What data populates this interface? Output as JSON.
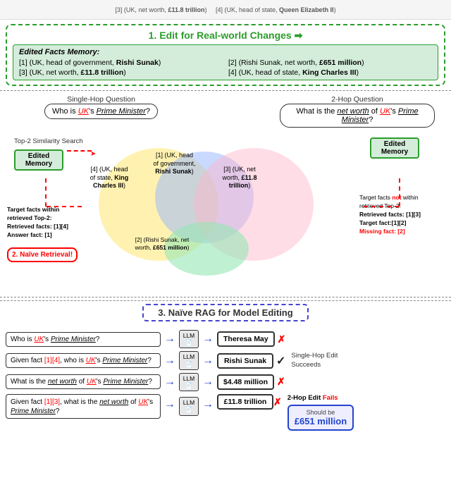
{
  "top_bar": {
    "text": "[3] (UK, net worth, £11.8 trillion)    [4] (UK, head of state, Queen Elizabeth II)"
  },
  "section1": {
    "title": "1. Edit for Real-world Changes",
    "facts_title": "Edited Facts Memory:",
    "facts": [
      {
        "num": "[1]",
        "content": "(UK, head of government, ",
        "bold": "Rishi Sunak",
        "end": ")"
      },
      {
        "num": "[2]",
        "content": "(Rishi Sunak, net worth, ",
        "bold": "£651 million",
        "end": ")"
      },
      {
        "num": "[3]",
        "content": "(UK, net worth, ",
        "bold": "£11.8 trillion",
        "end": ")"
      },
      {
        "num": "[4]",
        "content": "(UK, head of state, ",
        "bold": "King Charles III",
        "end": ")"
      }
    ]
  },
  "section2": {
    "q_left_label": "Single-Hop Question",
    "q_right_label": "2-Hop Question",
    "q_left": "Who is UK's Prime Minister?",
    "q_right": "What is the net worth of UK's Prime Minister?",
    "top2_label": "Top-2 Similarity Search",
    "edited_memory": "Edited Memory",
    "venn": {
      "left_text": "[4] (UK, head\nof state, King\nCharles III)",
      "center_text": "[1] (UK, head\nof government,\nRishi Sunak)",
      "right_text": "[3] (UK, net\nworth, £11.8\ntrillion)",
      "bottom_text": "[2] (Rishi Sunak, net\nworth, £651 million)"
    },
    "left_target": "Target facts within\nretrieved Top-2:\nRetrieved facts: [1][4]\nAnswer fact: [1]",
    "naive_retrieval": "2. Naïve Retrieval!",
    "right_target": "Target facts not within\nretrieved Top-2.\nRetrieved facts: [1][3]\nTarget fact:[1][2]\nMissing fact: [2]"
  },
  "section3": {
    "title": "3. Naïve RAG for Model Editing",
    "rows": [
      {
        "question": "Who is UK's Prime Minister?",
        "llm": "LLM",
        "answer": "Theresa May",
        "mark": "✗",
        "side": ""
      },
      {
        "question": "Given fact [1][4], who is UK's Prime Minister?",
        "llm": "LLM",
        "answer": "Rishi Sunak",
        "mark": "✓",
        "side": "Single-Hop Edit\nSucceeds"
      },
      {
        "question": "What is the net worth of UK's Prime Minister?",
        "llm": "LLM",
        "answer": "$4.48 million",
        "mark": "✗",
        "side": ""
      },
      {
        "question": "Given fact [1][3], what is the net worth of UK's Prime Minister?",
        "llm": "LLM",
        "answer": "£11.8 trillion",
        "mark": "✗",
        "side": "2-Hop Edit Fails"
      }
    ],
    "should_be_label": "Should be",
    "should_be_value": "£651 million"
  }
}
